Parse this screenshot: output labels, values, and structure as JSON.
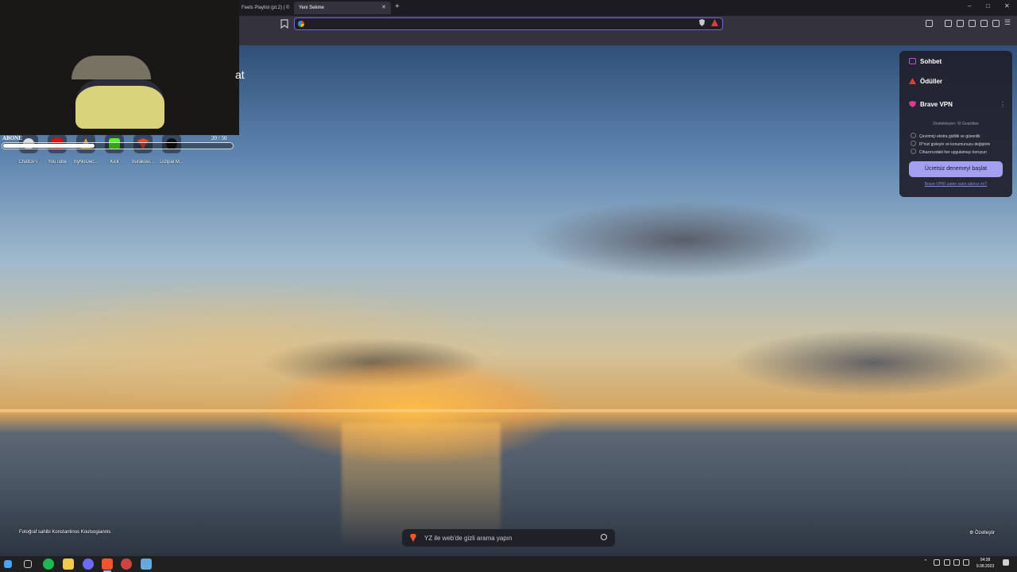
{
  "browser": {
    "tabs": [
      {
        "label": "Feels Playlist (pt.2) | ©",
        "active": false
      },
      {
        "label": "Yeni Sekme",
        "active": true
      }
    ],
    "new_tab_label": "+",
    "window_controls": {
      "minimize": "–",
      "maximize": "□",
      "close": "✕"
    },
    "url_value": "",
    "accent": "#7b62e3"
  },
  "webcam": {
    "partial_text": "at"
  },
  "subscriber_goal": {
    "label": "ABONE",
    "count": "20  /  50",
    "progress": 0.4
  },
  "shortcuts": [
    {
      "label": "ChatGPT",
      "icon": "chatgpt-icon",
      "color": "#1f1f2a"
    },
    {
      "label": "YouTube",
      "icon": "youtube-icon",
      "color": "#ff0000"
    },
    {
      "label": "ByNoDec...",
      "icon": "bynodec-icon",
      "color": "#d8a23a"
    },
    {
      "label": "Kick",
      "icon": "kick-icon",
      "color": "#53fc18"
    },
    {
      "label": "buraksei...",
      "icon": "buraksei-icon",
      "color": "#e04a2f"
    },
    {
      "label": "Dizipal M...",
      "icon": "dizipal-icon",
      "color": "#111111"
    }
  ],
  "side_panel": {
    "items": [
      {
        "label": "Sohbet",
        "icon": "chat-icon",
        "color": "#c14fd8"
      },
      {
        "label": "Ödüller",
        "icon": "rewards-icon",
        "color": "#e0393e"
      },
      {
        "label": "Brave VPN",
        "icon": "vpn-shield-icon",
        "color": "#d93d8f"
      }
    ],
    "powered_by": "Destekleyen: Ⓦ Guardian",
    "features": [
      "Çevrimiçi ekstra gizlilik ve güvenlik",
      "IP'nizi gizleyin ve konumunuzu değiştirin",
      "Cihazınızdaki her uygulamayı koruyun"
    ],
    "cta": "Ücretsiz denemeyi başlat",
    "link": "Brave VPN'i zaten satın aldınız mı?"
  },
  "new_tab_page": {
    "photo_credit": "Fotoğraf sahibi Konstantinos Koutsogiannis",
    "customize": "Özelleştir",
    "search_placeholder": "YZ ile web'de gizli arama yapın"
  },
  "taskbar": {
    "apps": [
      {
        "icon": "windows-start-icon",
        "color": "#4aa3ff"
      },
      {
        "icon": "task-view-icon",
        "color": "#cfcfcf"
      },
      {
        "icon": "spotify-icon",
        "color": "#1db954"
      },
      {
        "icon": "file-explorer-icon",
        "color": "#f2c94c"
      },
      {
        "icon": "discord-like-icon",
        "color": "#6b6bff"
      },
      {
        "icon": "brave-browser-icon",
        "color": "#f3552e"
      },
      {
        "icon": "obs-like-icon",
        "color": "#d04343"
      },
      {
        "icon": "steam-icon",
        "color": "#66aadd"
      }
    ],
    "time": "04:38",
    "date": "9.08.2023"
  }
}
